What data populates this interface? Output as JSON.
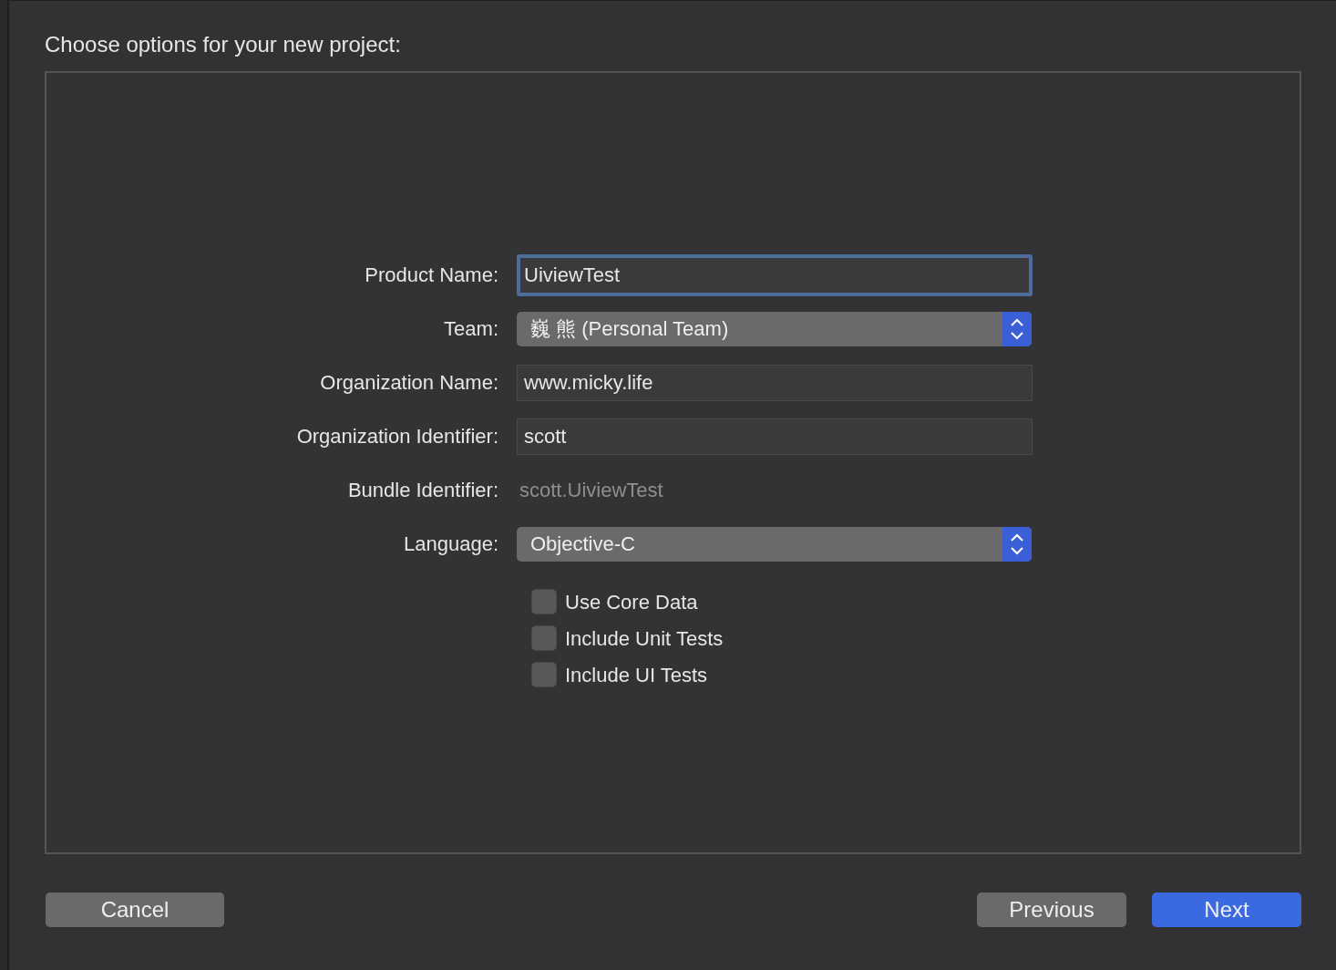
{
  "title": "Choose options for your new project:",
  "fields": [
    {
      "kind": "text",
      "label": "Product Name:",
      "value": "UiviewTest",
      "focused": true
    },
    {
      "kind": "popup",
      "label": "Team:",
      "value": "巍 熊 (Personal Team)"
    },
    {
      "kind": "text",
      "label": "Organization Name:",
      "value": "www.micky.life",
      "focused": false
    },
    {
      "kind": "text",
      "label": "Organization Identifier:",
      "value": "scott",
      "focused": false
    },
    {
      "kind": "static",
      "label": "Bundle Identifier:",
      "value": "scott.UiviewTest"
    },
    {
      "kind": "popup",
      "label": "Language:",
      "value": "Objective-C"
    }
  ],
  "checkboxes": [
    {
      "label": "Use Core Data",
      "checked": false
    },
    {
      "label": "Include Unit Tests",
      "checked": false
    },
    {
      "label": "Include UI Tests",
      "checked": false
    }
  ],
  "left_buttons": [
    {
      "label": "Cancel",
      "primary": false
    }
  ],
  "right_buttons": [
    {
      "label": "Previous",
      "primary": false
    },
    {
      "label": "Next",
      "primary": true
    }
  ]
}
